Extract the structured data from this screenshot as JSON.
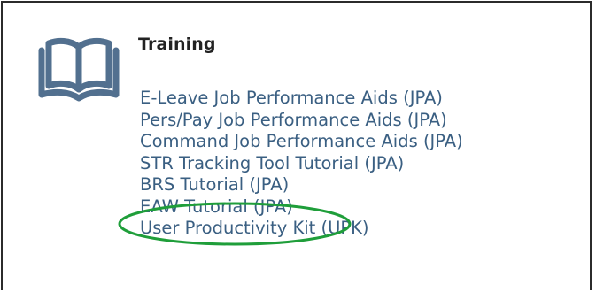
{
  "section": {
    "title": "Training",
    "icon": "open-book-icon"
  },
  "links": [
    "E-Leave Job Performance Aids (JPA)",
    "Pers/Pay Job Performance Aids (JPA)",
    "Command Job Performance Aids (JPA)",
    "STR Tracking Tool Tutorial (JPA)",
    "BRS Tutorial (JPA)",
    "EAW Tutorial (JPA)",
    "User Productivity Kit (UPK)"
  ],
  "colors": {
    "link": "#3a5f82",
    "icon": "#52708f",
    "highlight": "#1f9e3a",
    "border": "#2b2b2b"
  }
}
